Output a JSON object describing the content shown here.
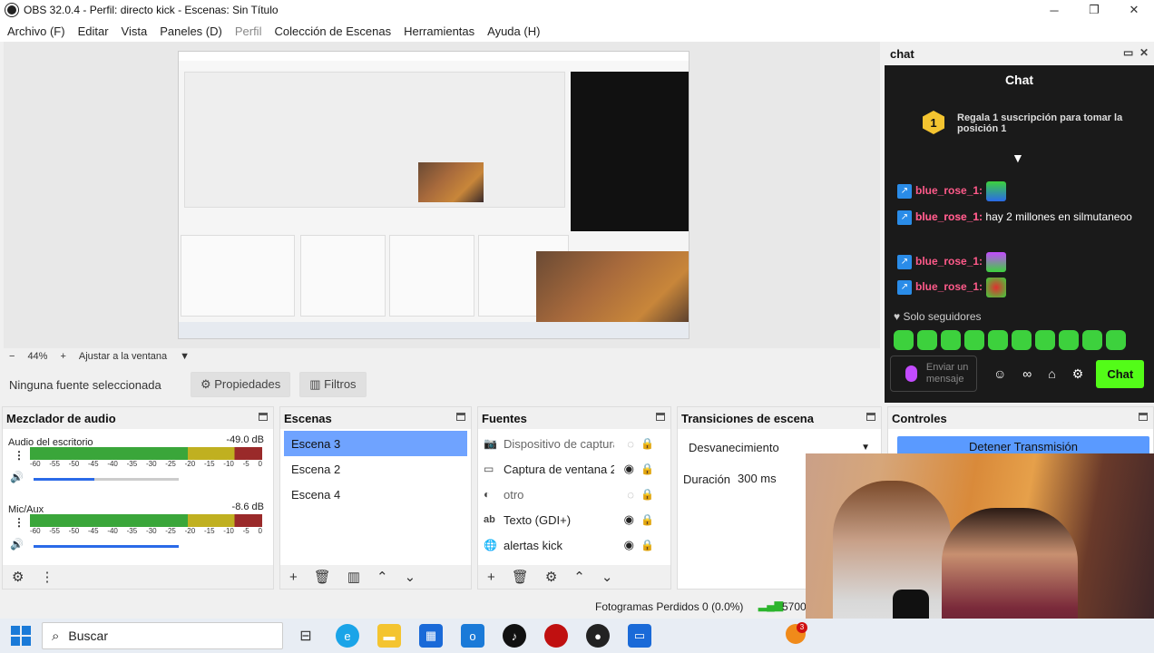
{
  "window": {
    "title": "OBS 32.0.4 - Perfil: directo kick - Escenas: Sin Título",
    "minimize": "─",
    "maximize": "❐",
    "close": "✕"
  },
  "menu": [
    "Archivo (F)",
    "Editar",
    "Vista",
    "Paneles (D)",
    "Perfil",
    "Colección de Escenas",
    "Herramientas",
    "Ayuda (H)"
  ],
  "zoom": {
    "minus": "−",
    "level": "44%",
    "plus": "+",
    "fit": "Ajustar a la ventana",
    "arrow": "▼"
  },
  "chat": {
    "dock_title": "chat",
    "title": "Chat",
    "gift_rank": "1",
    "gift_text": "Regala 1 suscripción para tomar la posición 1",
    "messages": [
      {
        "user": "blue_rose_1:",
        "text": ""
      },
      {
        "user": "blue_rose_1:",
        "text": ""
      },
      {
        "user": "blue_rose_1:",
        "text": "hay 2 millones en silmutaneoo"
      },
      {
        "user": "blue_rose_1:",
        "text": ""
      },
      {
        "user": "blue_rose_1:",
        "text": ""
      }
    ],
    "followers_only": "Solo seguidores",
    "input_placeholder": "Enviar un mensaje",
    "send": "Chat"
  },
  "source_toolbar": {
    "no_source": "Ninguna fuente seleccionada",
    "properties": "⚙ Propiedades",
    "filters": "▥ Filtros"
  },
  "mixer": {
    "title": "Mezclador de audio",
    "channels": [
      {
        "name": "Audio del escritorio",
        "db": "-49.0 dB",
        "volume": 0.42
      },
      {
        "name": "Mic/Aux",
        "db": "-8.6 dB",
        "volume": 1.0
      }
    ],
    "ticks": [
      "-60",
      "-55",
      "-50",
      "-45",
      "-40",
      "-35",
      "-30",
      "-25",
      "-20",
      "-15",
      "-10",
      "-5",
      "0"
    ]
  },
  "scenes": {
    "title": "Escenas",
    "items": [
      "Escena 3",
      "Escena 2",
      "Escena 4"
    ],
    "active_index": 0
  },
  "sources": {
    "title": "Fuentes",
    "items": [
      {
        "name": "Dispositivo de captura",
        "visible": false
      },
      {
        "name": "Captura de ventana 2",
        "visible": true
      },
      {
        "name": "otro",
        "visible": false
      },
      {
        "name": "Texto (GDI+)",
        "visible": true
      },
      {
        "name": "alertas kick",
        "visible": true
      }
    ]
  },
  "transitions": {
    "title": "Transiciones de escena",
    "selected": "Desvanecimiento",
    "duration_label": "Duración",
    "duration_value": "300 ms"
  },
  "controls": {
    "title": "Controles",
    "stop_stream": "Detener Transmisión"
  },
  "status": {
    "dropped_frames": "Fotogramas Perdidos 0 (0.0%)",
    "bitrate": "5700"
  },
  "taskbar": {
    "search_placeholder": "Buscar",
    "badge_count": "3"
  }
}
